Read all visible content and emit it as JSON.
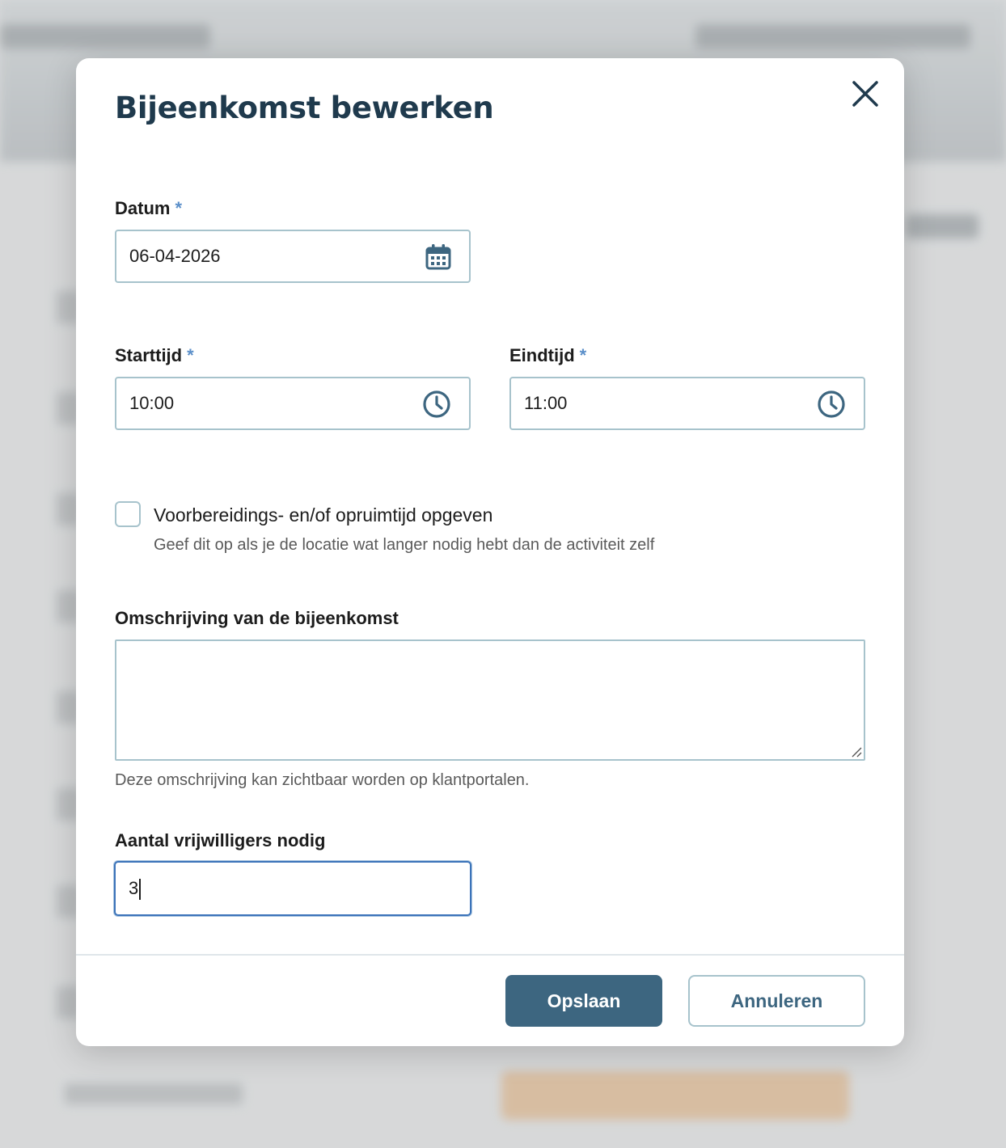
{
  "dialog": {
    "title": "Bijeenkomst bewerken",
    "close_icon": "close-icon"
  },
  "fields": {
    "date": {
      "label": "Datum",
      "required_mark": "*",
      "value": "06-04-2026",
      "icon": "calendar-icon"
    },
    "start_time": {
      "label": "Starttijd",
      "required_mark": "*",
      "value": "10:00",
      "icon": "clock-icon"
    },
    "end_time": {
      "label": "Eindtijd",
      "required_mark": "*",
      "value": "11:00",
      "icon": "clock-icon"
    },
    "prep_time": {
      "label": "Voorbereidings- en/of opruimtijd opgeven",
      "help": "Geef dit op als je de locatie wat langer nodig hebt dan de activiteit zelf",
      "checked": false
    },
    "description": {
      "label": "Omschrijving van de bijeenkomst",
      "value": "",
      "help": "Deze omschrijving kan zichtbaar worden op klantportalen."
    },
    "volunteers": {
      "label": "Aantal vrijwilligers nodig",
      "value": "3"
    }
  },
  "actions": {
    "save_label": "Opslaan",
    "cancel_label": "Annuleren"
  },
  "colors": {
    "primary": "#3d6680",
    "title": "#1f3a4d",
    "border": "#a7c3cc",
    "required": "#5b8fc9",
    "focus": "#3b73b9"
  }
}
